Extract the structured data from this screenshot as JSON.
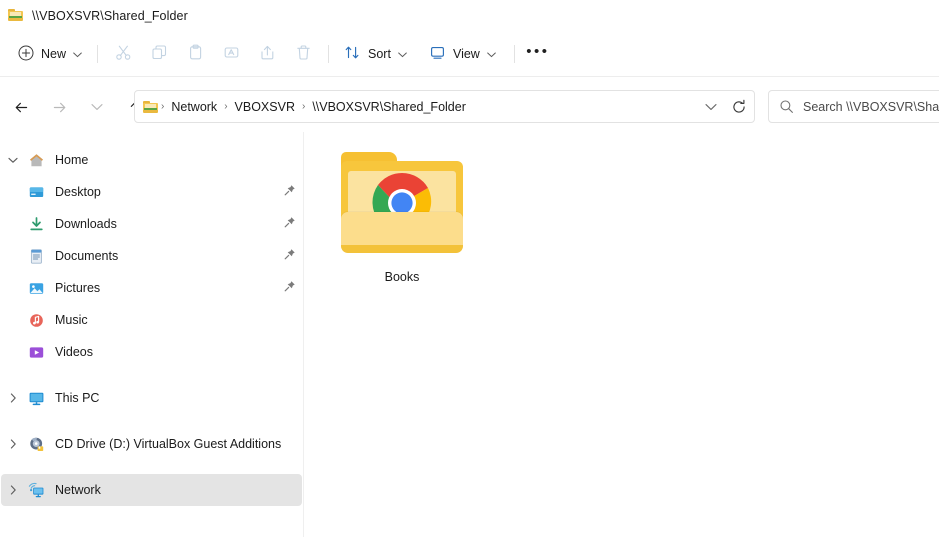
{
  "window": {
    "title": "\\\\VBOXSVR\\Shared_Folder",
    "title_icon": "network-folder-icon"
  },
  "toolbar": {
    "new_label": "New",
    "new_icon": "circle-plus-icon",
    "cut_icon": "scissors-icon",
    "copy_icon": "copy-icon",
    "paste_icon": "clipboard-paste-icon",
    "rename_icon": "rename-icon",
    "share_icon": "share-icon",
    "delete_icon": "trash-icon",
    "sort_label": "Sort",
    "sort_icon": "sort-arrows-icon",
    "view_label": "View",
    "view_icon": "monitor-icon",
    "more_label": "•••",
    "more_icon": "ellipsis-icon",
    "chevron": "⌄"
  },
  "navigation": {
    "back_icon": "arrow-left-icon",
    "forward_icon": "arrow-right-icon",
    "recent_icon": "chevron-down-icon",
    "up_icon": "arrow-up-icon",
    "breadcrumb_icon": "network-folder-icon",
    "breadcrumbs": [
      {
        "label": "Network"
      },
      {
        "label": "VBOXSVR"
      },
      {
        "label": "\\\\VBOXSVR\\Shared_Folder"
      }
    ],
    "separator": "›",
    "address_dropdown_icon": "chevron-down-icon",
    "refresh_icon": "refresh-icon"
  },
  "search": {
    "placeholder": "Search \\\\VBOXSVR\\Share",
    "icon": "search-icon"
  },
  "sidebar": {
    "items": [
      {
        "label": "Home",
        "icon": "home-icon",
        "chevron": "expanded",
        "pinned": false,
        "indent": false,
        "selected": false
      },
      {
        "label": "Desktop",
        "icon": "desktop-icon",
        "chevron": "none",
        "pinned": true,
        "indent": true,
        "selected": false
      },
      {
        "label": "Downloads",
        "icon": "downloads-icon",
        "chevron": "none",
        "pinned": true,
        "indent": true,
        "selected": false
      },
      {
        "label": "Documents",
        "icon": "documents-icon",
        "chevron": "none",
        "pinned": true,
        "indent": true,
        "selected": false
      },
      {
        "label": "Pictures",
        "icon": "pictures-icon",
        "chevron": "none",
        "pinned": true,
        "indent": true,
        "selected": false
      },
      {
        "label": "Music",
        "icon": "music-icon",
        "chevron": "none",
        "pinned": false,
        "indent": true,
        "selected": false
      },
      {
        "label": "Videos",
        "icon": "videos-icon",
        "chevron": "none",
        "pinned": false,
        "indent": true,
        "selected": false
      },
      {
        "label": "This PC",
        "icon": "this-pc-icon",
        "chevron": "collapsed",
        "pinned": false,
        "indent": false,
        "selected": false
      },
      {
        "label": "CD Drive (D:) VirtualBox Guest Additions",
        "icon": "cd-drive-icon",
        "chevron": "collapsed",
        "pinned": false,
        "indent": false,
        "selected": false
      },
      {
        "label": "Network",
        "icon": "network-icon",
        "chevron": "collapsed",
        "pinned": false,
        "indent": false,
        "selected": true
      }
    ],
    "pin_icon": "pin-icon",
    "chevron_expanded": "⌄",
    "chevron_collapsed": "›"
  },
  "content": {
    "items": [
      {
        "name": "Books",
        "icon": "folder-chrome-thumbnail-icon",
        "type": "folder"
      }
    ]
  },
  "colors": {
    "accent_blue": "#2a6fba",
    "folder_yellow": "#f7c63c",
    "folder_light": "#fcdd8c",
    "selection_gray": "#e4e4e4",
    "chrome_red": "#ea4335",
    "chrome_green": "#34a853",
    "chrome_yellow": "#fbbc05",
    "chrome_blue": "#4285f4"
  }
}
